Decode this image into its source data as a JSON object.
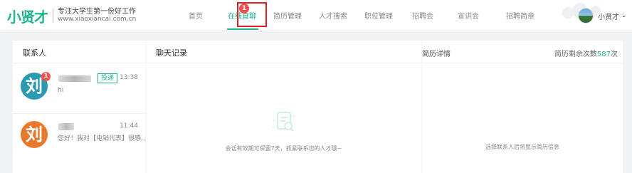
{
  "brand": {
    "logo": "小贤才",
    "slogan": "专注大学生第一份好工作",
    "url": "www.xiaoxiancai.com.cn"
  },
  "nav": {
    "items": [
      {
        "label": "首页",
        "active": false
      },
      {
        "label": "在线直聊",
        "active": true,
        "badge": "1"
      },
      {
        "label": "简历管理",
        "active": false
      },
      {
        "label": "人才搜索",
        "active": false
      },
      {
        "label": "职位管理",
        "active": false
      },
      {
        "label": "招聘会",
        "active": false
      },
      {
        "label": "宣讲会",
        "active": false
      },
      {
        "label": "招聘简章",
        "active": false
      }
    ]
  },
  "user": {
    "name": "小贤才",
    "caret": "⌄"
  },
  "contacts": {
    "title": "联系人",
    "items": [
      {
        "avatar": "刘",
        "badge": "1",
        "tag": "投递",
        "time": "13:38",
        "message": "hi",
        "avatar_color": "#2a9bb0"
      },
      {
        "avatar": "刘",
        "badge": "",
        "tag": "",
        "time": "11:44",
        "message": "您好！我对【电销代表】很感...",
        "avatar_color": "#e8782a"
      }
    ]
  },
  "chat": {
    "title": "聊天记录",
    "empty_text": "会话有效期可保留7天，抓紧联系您的人才哦~"
  },
  "resume": {
    "title": "简历详情",
    "remaining_prefix": "简历剩余次数",
    "remaining_count": "587",
    "remaining_suffix": "次",
    "empty_text": "选择联系人后将显示简历信息"
  },
  "colors": {
    "accent": "#1fb48d",
    "badge": "#f35151",
    "highlight": "#e02020"
  }
}
